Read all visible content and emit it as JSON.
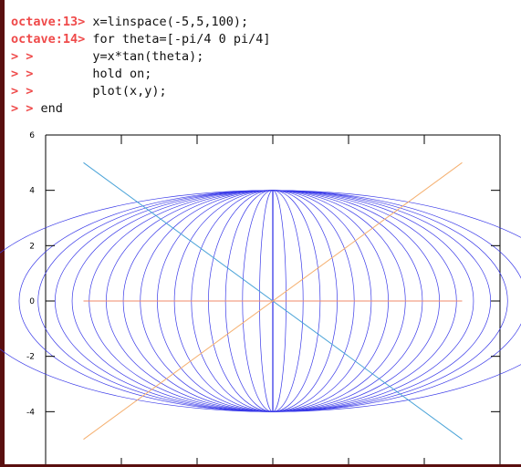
{
  "terminal": {
    "lines": [
      {
        "prompt": "octave:13>",
        "code": " x=linspace(-5,5,100);"
      },
      {
        "prompt": "octave:14>",
        "code": " for theta=[-pi/4 0 pi/4]"
      },
      {
        "prompt": "> >",
        "code": "        y=x*tan(theta);"
      },
      {
        "prompt": "> >",
        "code": "        hold on;"
      },
      {
        "prompt": "> >",
        "code": "        plot(x,y);"
      },
      {
        "prompt": "> >",
        "code": " end"
      }
    ]
  },
  "colors": {
    "prompt": "#ef4a4a",
    "frame": "#5a0f0f",
    "ellipse": "#3a3ae8",
    "line_neg": "#4aa3d8",
    "line_zero": "#f08a6a",
    "line_pos": "#f5b070"
  },
  "chart_data": {
    "type": "line",
    "title": "",
    "xlabel": "",
    "ylabel": "",
    "xlim": [
      -6,
      6
    ],
    "ylim": [
      -6,
      6
    ],
    "y_ticks": [
      "6",
      "4",
      "2",
      "0",
      "-2",
      "-4"
    ],
    "grid": false,
    "series": [
      {
        "x": [
          -5,
          5
        ],
        "y": [
          5,
          -5
        ]
      },
      {
        "x": [
          -5,
          5
        ],
        "y": [
          0,
          0
        ]
      },
      {
        "x": [
          -5,
          5
        ],
        "y": [
          -5,
          5
        ]
      }
    ],
    "ellipses": {
      "cx": 0,
      "cy": 0,
      "ry": 4,
      "rx_values": [
        0.35,
        0.8,
        1.25,
        1.7,
        2.15,
        2.6,
        3.05,
        3.5,
        3.95,
        4.4,
        4.85,
        5.3,
        5.75,
        6.2,
        6.7,
        8.0
      ]
    }
  }
}
